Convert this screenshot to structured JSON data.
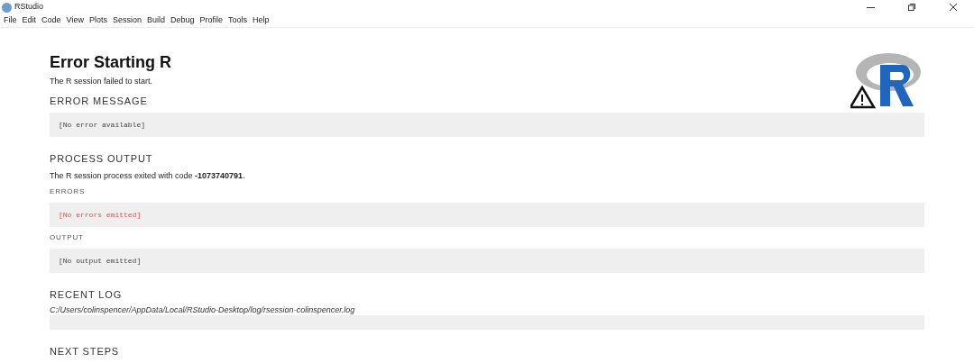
{
  "window": {
    "title": "RStudio"
  },
  "menu": [
    "File",
    "Edit",
    "Code",
    "View",
    "Plots",
    "Session",
    "Build",
    "Debug",
    "Profile",
    "Tools",
    "Help"
  ],
  "page": {
    "heading": "Error Starting R",
    "subtitle": "The R session failed to start.",
    "blocks": [
      {
        "kind": "section",
        "text": "ERROR MESSAGE"
      },
      {
        "kind": "code",
        "text": "[No error available]"
      },
      {
        "kind": "section",
        "text": "PROCESS OUTPUT"
      },
      {
        "kind": "text",
        "text": "The R session process exited with code **-1073740791**."
      },
      {
        "kind": "subsection",
        "text": "ERRORS"
      },
      {
        "kind": "error_code",
        "text": "[No errors emitted]"
      },
      {
        "kind": "subsection",
        "text": "OUTPUT"
      },
      {
        "kind": "code",
        "text": "[No output emitted]"
      },
      {
        "kind": "section",
        "text": "RECENT LOG"
      },
      {
        "kind": "path",
        "text": "C:/Users/colinspencer/AppData/Local/RStudio-Desktop/log/rsession-colinspencer.log"
      },
      {
        "kind": "empty_box"
      },
      {
        "kind": "section",
        "text": "NEXT STEPS"
      }
    ]
  }
}
